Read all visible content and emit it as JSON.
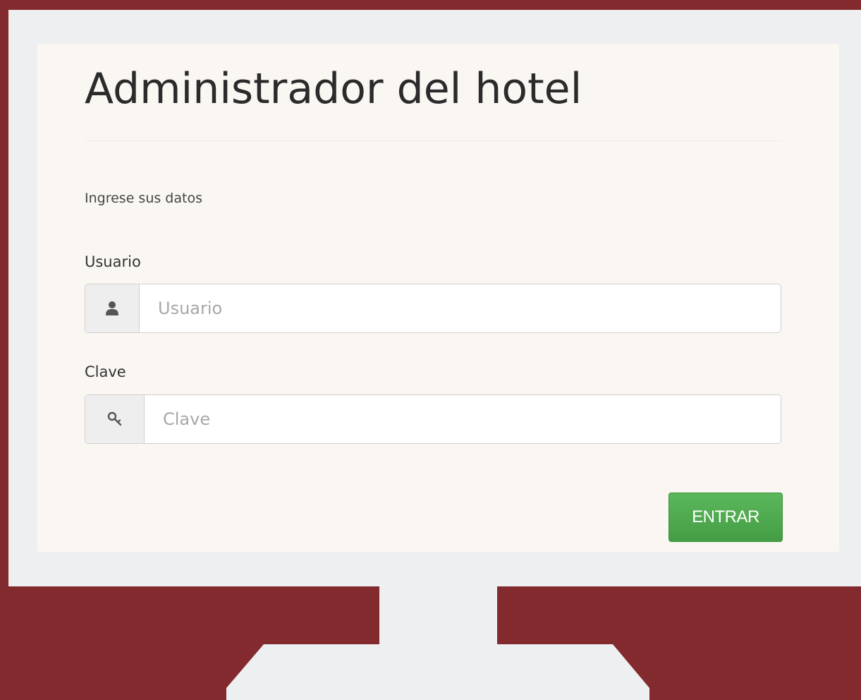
{
  "form": {
    "title": "Administrador del hotel",
    "intro": "Ingrese sus datos",
    "user": {
      "label": "Usuario",
      "placeholder": "Usuario",
      "value": "",
      "icon": "user-icon"
    },
    "password": {
      "label": "Clave",
      "placeholder": "Clave",
      "value": "",
      "icon": "key-icon"
    },
    "submit_label": "ENTRAR"
  },
  "colors": {
    "background": "#832a2e",
    "monitor": "#eeeff1",
    "panel": "#faf7f3",
    "button": "#4cae4c"
  }
}
